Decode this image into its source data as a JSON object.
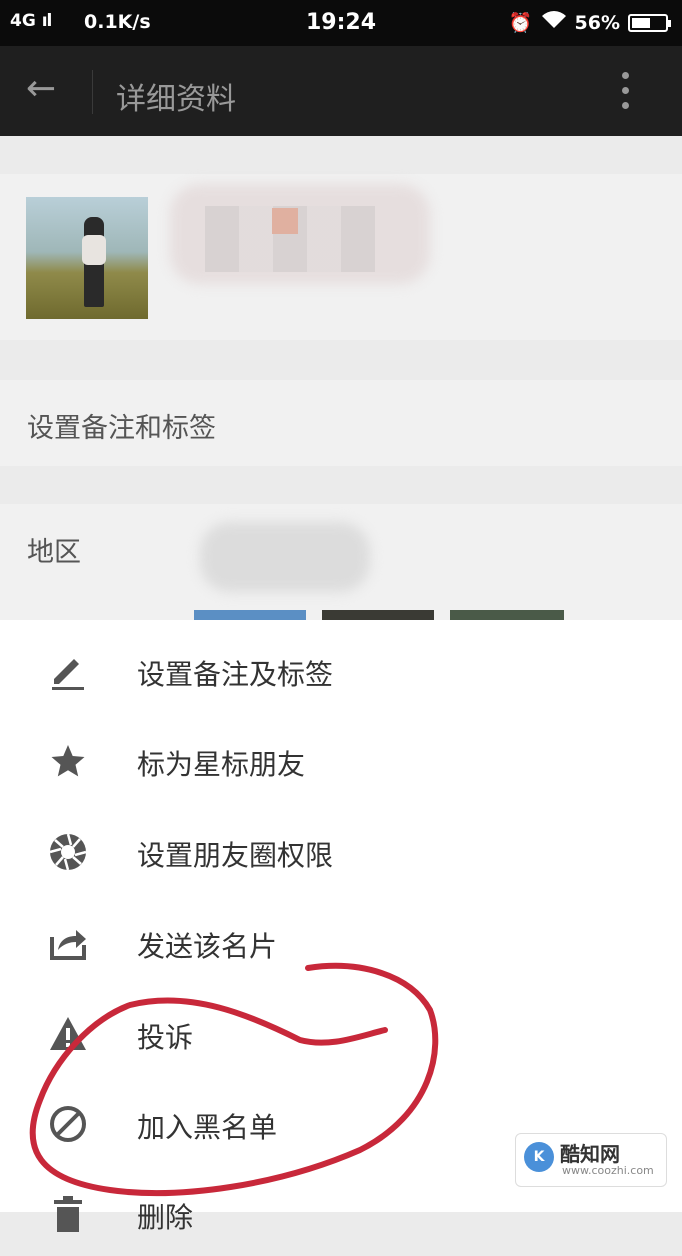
{
  "status_bar": {
    "network": "4G",
    "speed": "0.1K/s",
    "time": "19:24",
    "battery": "56%",
    "battery_level": 0.56
  },
  "header": {
    "title": "详细资料"
  },
  "rows": {
    "remark_label": "设置备注和标签",
    "region_label": "地区"
  },
  "menu": {
    "items": [
      {
        "label": "设置备注及标签",
        "icon": "pencil-icon"
      },
      {
        "label": "标为星标朋友",
        "icon": "star-icon"
      },
      {
        "label": "设置朋友圈权限",
        "icon": "aperture-icon"
      },
      {
        "label": "发送该名片",
        "icon": "share-icon"
      },
      {
        "label": "投诉",
        "icon": "warning-icon"
      },
      {
        "label": "加入黑名单",
        "icon": "block-icon"
      },
      {
        "label": "删除",
        "icon": "trash-icon"
      }
    ]
  },
  "watermark": {
    "logo": "K",
    "name": "酷知网",
    "url": "www.coozhi.com"
  },
  "colors": {
    "sheet_bg": "#ffffff",
    "dim_bg": "#ebebeb",
    "header_bg": "#1f1f1f",
    "annotation": "#c8283a",
    "icon": "#555555"
  }
}
